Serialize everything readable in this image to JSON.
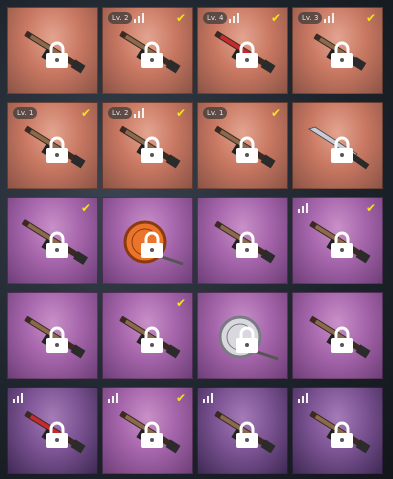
{
  "colors": {
    "rarity_red": "#c97862",
    "rarity_purple": "#a665ab",
    "rarity_purple_dark": "#7c5393",
    "check_yellow": "#f4e21a",
    "lock_white": "#ffffff"
  },
  "icons": {
    "lock": "lock-icon",
    "check": "checkmark-icon",
    "bars": "signal-bars-icon"
  },
  "tiles": [
    {
      "rarity": "red",
      "weapon": "rifle",
      "level": "",
      "bars": false,
      "checked": false,
      "locked": true
    },
    {
      "rarity": "red",
      "weapon": "rifle",
      "level": "Lv. 2",
      "bars": true,
      "checked": true,
      "locked": true
    },
    {
      "rarity": "red",
      "weapon": "shotgun",
      "level": "Lv. 4",
      "bars": true,
      "checked": true,
      "locked": true
    },
    {
      "rarity": "red",
      "weapon": "smg",
      "level": "Lv. 3",
      "bars": true,
      "checked": true,
      "locked": true
    },
    {
      "rarity": "red",
      "weapon": "rifle",
      "level": "Lv. 1",
      "bars": false,
      "checked": true,
      "locked": true
    },
    {
      "rarity": "red",
      "weapon": "rifle",
      "level": "Lv. 2",
      "bars": true,
      "checked": true,
      "locked": true
    },
    {
      "rarity": "red",
      "weapon": "rifle",
      "level": "Lv. 1",
      "bars": false,
      "checked": true,
      "locked": true
    },
    {
      "rarity": "red",
      "weapon": "knife",
      "level": "",
      "bars": false,
      "checked": false,
      "locked": true
    },
    {
      "rarity": "purple",
      "weapon": "sniper",
      "level": "",
      "bars": false,
      "checked": true,
      "locked": true
    },
    {
      "rarity": "purple",
      "weapon": "pan-orange",
      "level": "",
      "bars": false,
      "checked": false,
      "locked": true
    },
    {
      "rarity": "purple",
      "weapon": "rifle",
      "level": "",
      "bars": false,
      "checked": false,
      "locked": true
    },
    {
      "rarity": "purple",
      "weapon": "rifle",
      "level": "",
      "bars": true,
      "checked": true,
      "locked": true
    },
    {
      "rarity": "purple",
      "weapon": "rifle",
      "level": "",
      "bars": false,
      "checked": false,
      "locked": true
    },
    {
      "rarity": "purple",
      "weapon": "rifle",
      "level": "",
      "bars": false,
      "checked": true,
      "locked": true
    },
    {
      "rarity": "purple",
      "weapon": "pan-silver",
      "level": "",
      "bars": false,
      "checked": false,
      "locked": true
    },
    {
      "rarity": "purple",
      "weapon": "rifle",
      "level": "",
      "bars": false,
      "checked": false,
      "locked": true
    },
    {
      "rarity": "purple-dark",
      "weapon": "shotgun",
      "level": "",
      "bars": true,
      "checked": false,
      "locked": true
    },
    {
      "rarity": "purple",
      "weapon": "rifle",
      "level": "",
      "bars": true,
      "checked": true,
      "locked": true
    },
    {
      "rarity": "purple-dark",
      "weapon": "rifle",
      "level": "",
      "bars": true,
      "checked": false,
      "locked": true
    },
    {
      "rarity": "purple-dark",
      "weapon": "rifle",
      "level": "",
      "bars": true,
      "checked": false,
      "locked": true
    }
  ]
}
